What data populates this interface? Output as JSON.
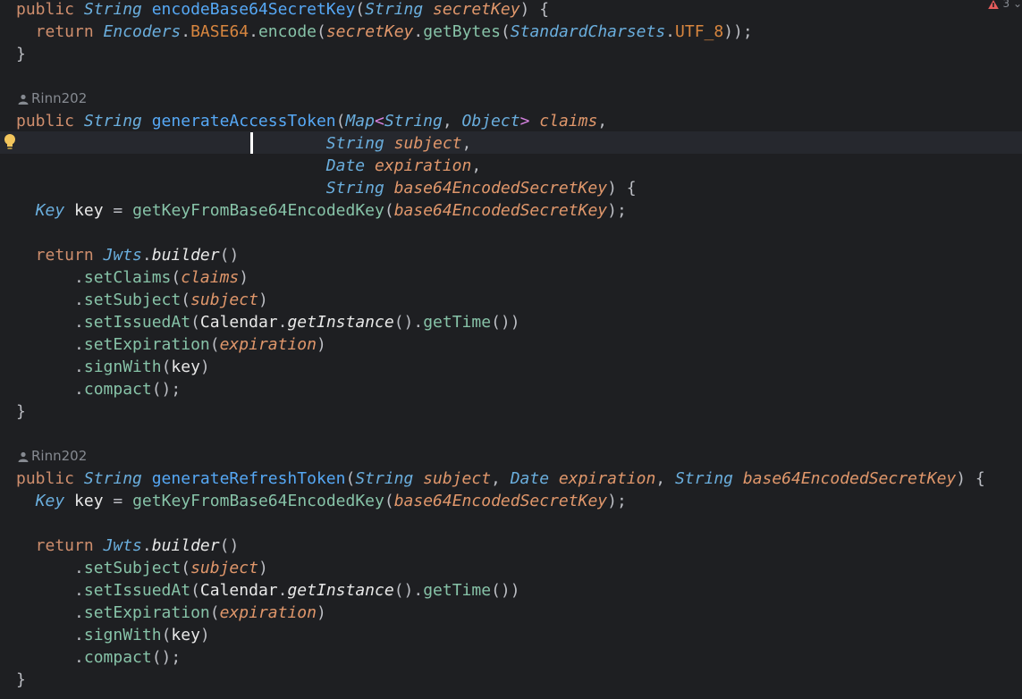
{
  "editor": {
    "inspection_count": "3",
    "authors": [
      "Rinn202",
      "Rinn202"
    ],
    "lines": [
      [
        [
          "kw",
          "public "
        ],
        [
          "ty",
          "String "
        ],
        [
          "fn",
          "encodeBase64SecretKey"
        ],
        [
          "pu",
          "("
        ],
        [
          "ty",
          "String "
        ],
        [
          "pa",
          "secretKey"
        ],
        [
          "pu",
          ") {"
        ]
      ],
      [
        [
          "kw",
          "  return "
        ],
        [
          "cl",
          "Encoders"
        ],
        [
          "pu",
          "."
        ],
        [
          "st",
          "BASE64"
        ],
        [
          "pu",
          "."
        ],
        [
          "mc",
          "encode"
        ],
        [
          "pu",
          "("
        ],
        [
          "pa",
          "secretKey"
        ],
        [
          "pu",
          "."
        ],
        [
          "mc",
          "getBytes"
        ],
        [
          "pu",
          "("
        ],
        [
          "cl",
          "StandardCharsets"
        ],
        [
          "pu",
          "."
        ],
        [
          "st",
          "UTF_8"
        ],
        [
          "pu",
          "));"
        ]
      ],
      [
        [
          "pu",
          "}"
        ]
      ],
      [
        [
          "kw",
          "public "
        ],
        [
          "ty",
          "String "
        ],
        [
          "fn",
          "generateAccessToken"
        ],
        [
          "pu",
          "("
        ],
        [
          "ty",
          "Map"
        ],
        [
          "ge",
          "<"
        ],
        [
          "ty",
          "String"
        ],
        [
          "pu",
          ", "
        ],
        [
          "ty",
          "Object"
        ],
        [
          "ge",
          "> "
        ],
        [
          "pa",
          "claims"
        ],
        [
          "pu",
          ","
        ]
      ],
      [
        [
          "pu",
          "                                "
        ],
        [
          "ty",
          "String "
        ],
        [
          "pa",
          "subject"
        ],
        [
          "pu",
          ","
        ]
      ],
      [
        [
          "pu",
          "                                "
        ],
        [
          "ty",
          "Date "
        ],
        [
          "pa",
          "expiration"
        ],
        [
          "pu",
          ","
        ]
      ],
      [
        [
          "pu",
          "                                "
        ],
        [
          "ty",
          "String "
        ],
        [
          "pa",
          "base64EncodedSecretKey"
        ],
        [
          "pu",
          ") {"
        ]
      ],
      [
        [
          "pu",
          "  "
        ],
        [
          "ty",
          "Key "
        ],
        [
          "lv",
          "key "
        ],
        [
          "pu",
          "= "
        ],
        [
          "mc",
          "getKeyFromBase64EncodedKey"
        ],
        [
          "pu",
          "("
        ],
        [
          "pa",
          "base64EncodedSecretKey"
        ],
        [
          "pu",
          ");"
        ]
      ],
      [
        [
          "kw",
          "  return "
        ],
        [
          "cl",
          "Jwts"
        ],
        [
          "pu",
          "."
        ],
        [
          "sm",
          "builder"
        ],
        [
          "pu",
          "()"
        ]
      ],
      [
        [
          "pu",
          "      ."
        ],
        [
          "mc",
          "setClaims"
        ],
        [
          "pu",
          "("
        ],
        [
          "pa",
          "claims"
        ],
        [
          "pu",
          ")"
        ]
      ],
      [
        [
          "pu",
          "      ."
        ],
        [
          "mc",
          "setSubject"
        ],
        [
          "pu",
          "("
        ],
        [
          "pa",
          "subject"
        ],
        [
          "pu",
          ")"
        ]
      ],
      [
        [
          "pu",
          "      ."
        ],
        [
          "mc",
          "setIssuedAt"
        ],
        [
          "pu",
          "("
        ],
        [
          "lv",
          "Calendar"
        ],
        [
          "pu",
          "."
        ],
        [
          "sm",
          "getInstance"
        ],
        [
          "pu",
          "()."
        ],
        [
          "mc",
          "getTime"
        ],
        [
          "pu",
          "())"
        ]
      ],
      [
        [
          "pu",
          "      ."
        ],
        [
          "mc",
          "setExpiration"
        ],
        [
          "pu",
          "("
        ],
        [
          "pa",
          "expiration"
        ],
        [
          "pu",
          ")"
        ]
      ],
      [
        [
          "pu",
          "      ."
        ],
        [
          "mc",
          "signWith"
        ],
        [
          "pu",
          "("
        ],
        [
          "lv",
          "key"
        ],
        [
          "pu",
          ")"
        ]
      ],
      [
        [
          "pu",
          "      ."
        ],
        [
          "mc",
          "compact"
        ],
        [
          "pu",
          "();"
        ]
      ],
      [
        [
          "pu",
          "}"
        ]
      ],
      [
        [
          "kw",
          "public "
        ],
        [
          "ty",
          "String "
        ],
        [
          "fn",
          "generateRefreshToken"
        ],
        [
          "pu",
          "("
        ],
        [
          "ty",
          "String "
        ],
        [
          "pa",
          "subject"
        ],
        [
          "pu",
          ", "
        ],
        [
          "ty",
          "Date "
        ],
        [
          "pa",
          "expiration"
        ],
        [
          "pu",
          ", "
        ],
        [
          "ty",
          "String "
        ],
        [
          "pa",
          "base64EncodedSecretKey"
        ],
        [
          "pu",
          ") {"
        ]
      ],
      [
        [
          "pu",
          "  "
        ],
        [
          "ty",
          "Key "
        ],
        [
          "lv",
          "key "
        ],
        [
          "pu",
          "= "
        ],
        [
          "mc",
          "getKeyFromBase64EncodedKey"
        ],
        [
          "pu",
          "("
        ],
        [
          "pa",
          "base64EncodedSecretKey"
        ],
        [
          "pu",
          ");"
        ]
      ],
      [
        [
          "kw",
          "  return "
        ],
        [
          "cl",
          "Jwts"
        ],
        [
          "pu",
          "."
        ],
        [
          "sm",
          "builder"
        ],
        [
          "pu",
          "()"
        ]
      ],
      [
        [
          "pu",
          "      ."
        ],
        [
          "mc",
          "setSubject"
        ],
        [
          "pu",
          "("
        ],
        [
          "pa",
          "subject"
        ],
        [
          "pu",
          ")"
        ]
      ],
      [
        [
          "pu",
          "      ."
        ],
        [
          "mc",
          "setIssuedAt"
        ],
        [
          "pu",
          "("
        ],
        [
          "lv",
          "Calendar"
        ],
        [
          "pu",
          "."
        ],
        [
          "sm",
          "getInstance"
        ],
        [
          "pu",
          "()."
        ],
        [
          "mc",
          "getTime"
        ],
        [
          "pu",
          "())"
        ]
      ],
      [
        [
          "pu",
          "      ."
        ],
        [
          "mc",
          "setExpiration"
        ],
        [
          "pu",
          "("
        ],
        [
          "pa",
          "expiration"
        ],
        [
          "pu",
          ")"
        ]
      ],
      [
        [
          "pu",
          "      ."
        ],
        [
          "mc",
          "signWith"
        ],
        [
          "pu",
          "("
        ],
        [
          "lv",
          "key"
        ],
        [
          "pu",
          ")"
        ]
      ],
      [
        [
          "pu",
          "      ."
        ],
        [
          "mc",
          "compact"
        ],
        [
          "pu",
          "();"
        ]
      ],
      [
        [
          "pu",
          "}"
        ]
      ]
    ]
  }
}
